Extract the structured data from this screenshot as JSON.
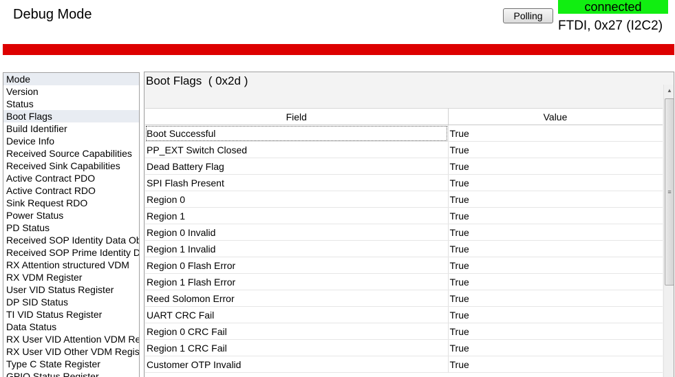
{
  "header": {
    "title": "Debug Mode",
    "polling_label": "Polling",
    "status": "connected",
    "status_color": "#11ee11",
    "connection": "FTDI, 0x27 (I2C2)",
    "alert_bar_color": "#dd0000"
  },
  "sidebar": {
    "items": [
      {
        "label": "Mode"
      },
      {
        "label": "Version"
      },
      {
        "label": "Status"
      },
      {
        "label": "Boot Flags"
      },
      {
        "label": "Build Identifier"
      },
      {
        "label": "Device Info"
      },
      {
        "label": "Received Source Capabilities"
      },
      {
        "label": "Received Sink Capabilities"
      },
      {
        "label": "Active Contract PDO"
      },
      {
        "label": "Active Contract RDO"
      },
      {
        "label": "Sink Request RDO"
      },
      {
        "label": "Power Status"
      },
      {
        "label": "PD Status"
      },
      {
        "label": "Received SOP Identity Data Object"
      },
      {
        "label": "Received SOP Prime Identity Data Object"
      },
      {
        "label": "RX Attention structured VDM"
      },
      {
        "label": "RX VDM Register"
      },
      {
        "label": "User VID Status Register"
      },
      {
        "label": "DP SID Status"
      },
      {
        "label": "TI VID Status Register"
      },
      {
        "label": "Data Status"
      },
      {
        "label": "RX User VID Attention VDM Register"
      },
      {
        "label": "RX User VID Other VDM Register"
      },
      {
        "label": "Type C State Register"
      },
      {
        "label": "GPIO Status Register"
      }
    ],
    "selected": "Boot Flags"
  },
  "panel": {
    "title": "Boot Flags",
    "address": "( 0x2d )"
  },
  "table": {
    "columns": [
      "Field",
      "Value"
    ],
    "rows": [
      {
        "field": "Boot Successful",
        "value": "True"
      },
      {
        "field": "PP_EXT Switch Closed",
        "value": "True"
      },
      {
        "field": "Dead Battery Flag",
        "value": "True"
      },
      {
        "field": "SPI Flash Present",
        "value": "True"
      },
      {
        "field": "Region 0",
        "value": "True"
      },
      {
        "field": "Region 1",
        "value": "True"
      },
      {
        "field": "Region 0 Invalid",
        "value": "True"
      },
      {
        "field": "Region 1 Invalid",
        "value": "True"
      },
      {
        "field": "Region 0 Flash Error",
        "value": "True"
      },
      {
        "field": "Region 1 Flash Error",
        "value": "True"
      },
      {
        "field": "Reed Solomon Error",
        "value": "True"
      },
      {
        "field": "UART CRC Fail",
        "value": "True"
      },
      {
        "field": "Region 0 CRC Fail",
        "value": "True"
      },
      {
        "field": "Region 1 CRC Fail",
        "value": "True"
      },
      {
        "field": "Customer OTP Invalid",
        "value": "True"
      }
    ]
  }
}
